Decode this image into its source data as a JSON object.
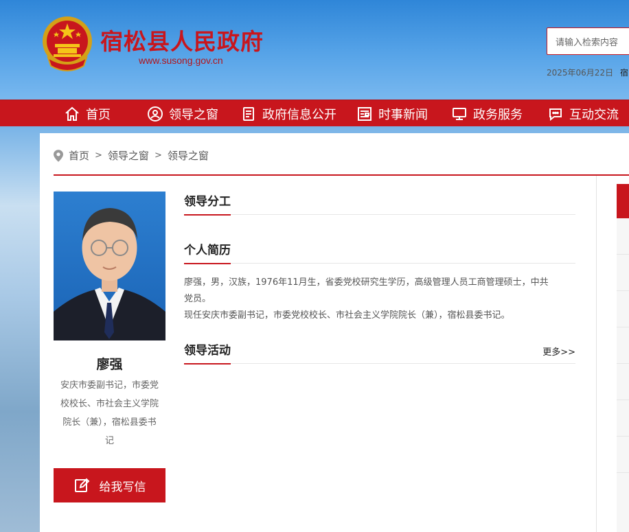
{
  "header": {
    "site_title": "宿松县人民政府",
    "site_url": "www.susong.gov.cn",
    "search_placeholder": "请输入检索内容",
    "date": "2025年06月22日",
    "date_suffix": "宿"
  },
  "nav": {
    "items": [
      {
        "label": "首页",
        "icon": "home-icon"
      },
      {
        "label": "领导之窗",
        "icon": "leader-icon"
      },
      {
        "label": "政府信息公开",
        "icon": "document-icon"
      },
      {
        "label": "时事新闻",
        "icon": "news-icon"
      },
      {
        "label": "政务服务",
        "icon": "monitor-icon"
      },
      {
        "label": "互动交流",
        "icon": "chat-icon"
      }
    ]
  },
  "breadcrumb": {
    "icon": "location-pin-icon",
    "items": [
      "首页",
      "领导之窗",
      "领导之窗"
    ],
    "separator": ">"
  },
  "leader": {
    "name": "廖强",
    "title_lines": [
      "安庆市委副书记，市委党",
      "校校长、市社会主义学院",
      "院长（兼），宿松县委书",
      "记"
    ],
    "write_button": "给我写信",
    "write_icon": "edit-icon"
  },
  "sections": {
    "duty": {
      "title": "领导分工"
    },
    "resume": {
      "title": "个人简历",
      "lines": [
        "廖强，男，汉族，1976年11月生，省委党校研究生学历，高级管理人员工商管理硕士，中共",
        "党员。",
        "现任安庆市委副书记，市委党校校长、市社会主义学院院长（兼），宿松县委书记。"
      ]
    },
    "activity": {
      "title": "领导活动",
      "more": "更多>>"
    }
  },
  "colors": {
    "brand_red": "#c8161d",
    "sky_blue": "#4f9ee3"
  }
}
